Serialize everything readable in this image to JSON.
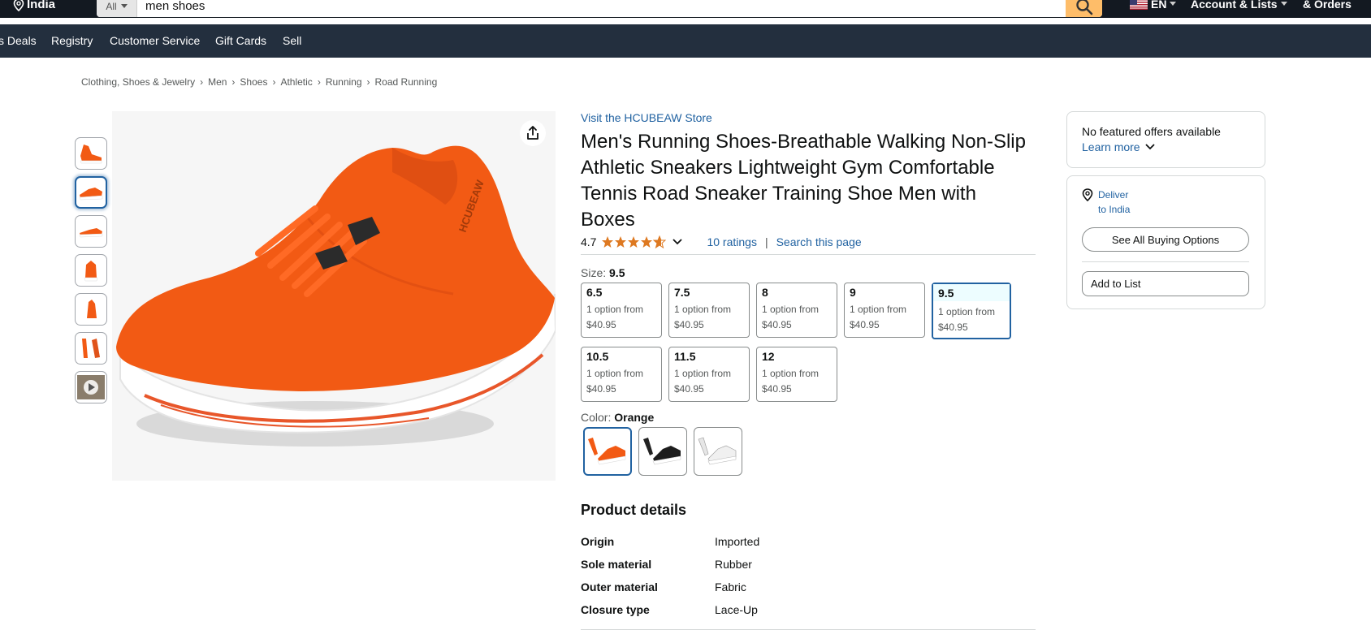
{
  "header": {
    "location": "India",
    "search_category": "All",
    "search_value": "men shoes",
    "language": "EN",
    "account": "Account & Lists",
    "orders": "& Orders"
  },
  "subnav": {
    "items": [
      "s Deals",
      "Registry",
      "Customer Service",
      "Gift Cards",
      "Sell"
    ]
  },
  "breadcrumb": [
    "Clothing, Shoes & Jewelry",
    "Men",
    "Shoes",
    "Athletic",
    "Running",
    "Road Running"
  ],
  "product": {
    "store_link": "Visit the HCUBEAW Store",
    "title": "Men's Running Shoes-Breathable Walking Non-Slip Athletic Sneakers Lightweight Gym Comfortable Tennis Road Sneaker Training Shoe Men with Boxes",
    "rating": "4.7",
    "rating_stars": 4.7,
    "ratings_count": "10 ratings",
    "search_page": "Search this page",
    "size_label": "Size:",
    "size_selected": "9.5",
    "sizes": [
      {
        "size": "6.5",
        "line1": "1 option from",
        "price": "$40.95"
      },
      {
        "size": "7.5",
        "line1": "1 option from",
        "price": "$40.95"
      },
      {
        "size": "8",
        "line1": "1 option from",
        "price": "$40.95"
      },
      {
        "size": "9",
        "line1": "1 option from",
        "price": "$40.95"
      },
      {
        "size": "9.5",
        "line1": "1 option from",
        "price": "$40.95"
      },
      {
        "size": "10.5",
        "line1": "1 option from",
        "price": "$40.95"
      },
      {
        "size": "11.5",
        "line1": "1 option from",
        "price": "$40.95"
      },
      {
        "size": "12",
        "line1": "1 option from",
        "price": "$40.95"
      }
    ],
    "color_label": "Color:",
    "color_selected": "Orange",
    "details_heading": "Product details",
    "details": [
      {
        "key": "Origin",
        "value": "Imported"
      },
      {
        "key": "Sole material",
        "value": "Rubber"
      },
      {
        "key": "Outer material",
        "value": "Fabric"
      },
      {
        "key": "Closure type",
        "value": "Lace-Up"
      }
    ]
  },
  "buybox": {
    "no_offers": "No featured offers available",
    "learn_more": "Learn more",
    "deliver_line1": "Deliver",
    "deliver_line2": "to India",
    "see_all": "See All Buying Options",
    "add_to_list": "Add to List"
  },
  "colors": {
    "header_bg": "#131921",
    "subnav_bg": "#232f3e",
    "search_button": "#febd69",
    "link": "#2162a1",
    "star": "#de7921",
    "shoe_orange": "#f25a14"
  }
}
